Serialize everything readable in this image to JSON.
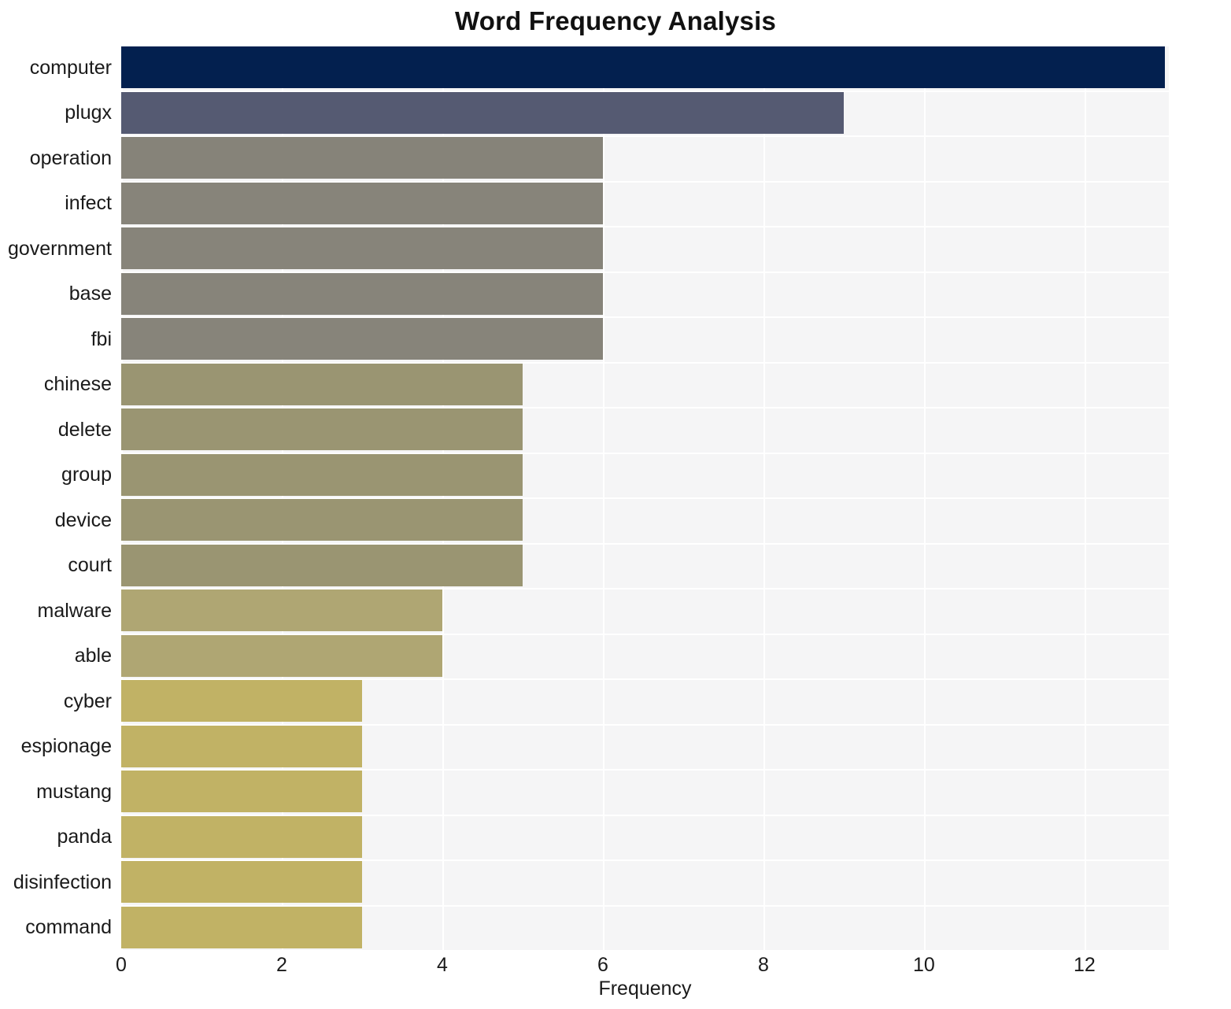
{
  "chart_data": {
    "type": "bar",
    "orientation": "horizontal",
    "title": "Word Frequency Analysis",
    "xlabel": "Frequency",
    "ylabel": "",
    "categories": [
      "computer",
      "plugx",
      "operation",
      "infect",
      "government",
      "base",
      "fbi",
      "chinese",
      "delete",
      "group",
      "device",
      "court",
      "malware",
      "able",
      "cyber",
      "espionage",
      "mustang",
      "panda",
      "disinfection",
      "command"
    ],
    "values": [
      13,
      9,
      6,
      6,
      6,
      6,
      6,
      5,
      5,
      5,
      5,
      5,
      4,
      4,
      3,
      3,
      3,
      3,
      3,
      3
    ],
    "bar_colors": [
      "#03204f",
      "#555a72",
      "#868379",
      "#87847a",
      "#87847a",
      "#87847a",
      "#87847a",
      "#9a9572",
      "#9a9572",
      "#9a9572",
      "#9a9572",
      "#9a9572",
      "#afa673",
      "#afa673",
      "#c1b265",
      "#c1b265",
      "#c1b265",
      "#c1b265",
      "#c1b265",
      "#c1b265"
    ],
    "xlim": [
      0,
      13.05
    ],
    "x_ticks": [
      0,
      2,
      4,
      6,
      8,
      10,
      12
    ],
    "x_tick_labels": [
      "0",
      "2",
      "4",
      "6",
      "8",
      "10",
      "12"
    ],
    "grid": true,
    "grid_color": "#ffffff",
    "plot_background": "#f5f5f6",
    "figure_background": "#ffffff",
    "legend": null,
    "legend_position": "none"
  }
}
